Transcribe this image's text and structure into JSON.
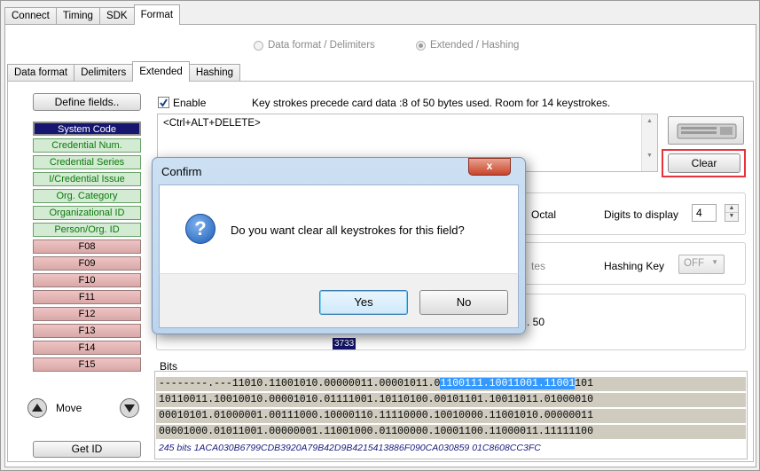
{
  "top_tabs": [
    "Connect",
    "Timing",
    "SDK",
    "Format"
  ],
  "mode_options": {
    "data_format": "Data format / Delimiters",
    "extended": "Extended / Hashing"
  },
  "sub_tabs": [
    "Data format",
    "Delimiters",
    "Extended",
    "Hashing"
  ],
  "define_fields_label": "Define fields..",
  "fields": [
    {
      "label": "System Code",
      "style": "dark"
    },
    {
      "label": "Credential Num.",
      "style": "green"
    },
    {
      "label": "Credential Series",
      "style": "green"
    },
    {
      "label": "I/Credential Issue",
      "style": "green"
    },
    {
      "label": "Org. Category",
      "style": "green"
    },
    {
      "label": "Organizational ID",
      "style": "green"
    },
    {
      "label": "Person/Org. ID",
      "style": "green"
    },
    {
      "label": "F08",
      "style": "pink"
    },
    {
      "label": "F09",
      "style": "pink"
    },
    {
      "label": "F10",
      "style": "pink"
    },
    {
      "label": "F11",
      "style": "pink"
    },
    {
      "label": "F12",
      "style": "pink"
    },
    {
      "label": "F13",
      "style": "pink"
    },
    {
      "label": "F14",
      "style": "pink"
    },
    {
      "label": "F15",
      "style": "pink"
    }
  ],
  "move_label": "Move",
  "get_id_label": "Get ID",
  "enable_label": "Enable",
  "enable_checked": true,
  "keystroke_info": "Key strokes precede card data :8 of 50 bytes used. Room for 14 keystrokes.",
  "keystroke_text": "<Ctrl+ALT+DELETE>",
  "clear_label": "Clear",
  "octal_label": "Octal",
  "digits_label": "Digits to display",
  "digits_value": "4",
  "hashing_partial": "tes",
  "hashing_key_label": "Hashing Key",
  "hashing_key_value": "OFF",
  "range_partial": ". 50",
  "badge_value": "3733",
  "bits_label": "Bits",
  "bits_lines": [
    {
      "pre": "--------.---11010.11001010.00000011.00001011.0",
      "hl": "1100111.10011001.11001",
      "post": "101"
    },
    {
      "pre": "10110011.10010010.00001010.01111001.10110100.00101101.10011011.01000010",
      "hl": "",
      "post": ""
    },
    {
      "pre": "00010101.01000001.00111000.10000110.11110000.10010000.11001010.00000011",
      "hl": "",
      "post": ""
    },
    {
      "pre": "00001000.01011001.00000001.11001000.01100000.10001100.11000011.11111100",
      "hl": "",
      "post": ""
    }
  ],
  "bits_summary": "245 bits 1ACA030B6799CDB3920A79B42D9B4215413886F090CA030859 01C8608CC3FC",
  "dialog": {
    "title": "Confirm",
    "message": "Do you want clear all keystrokes for this field?",
    "yes": "Yes",
    "no": "No",
    "close": "x"
  },
  "colors": {
    "accent_red": "#e8333a",
    "selection": "#3399ff",
    "field_dark": "#161670"
  }
}
